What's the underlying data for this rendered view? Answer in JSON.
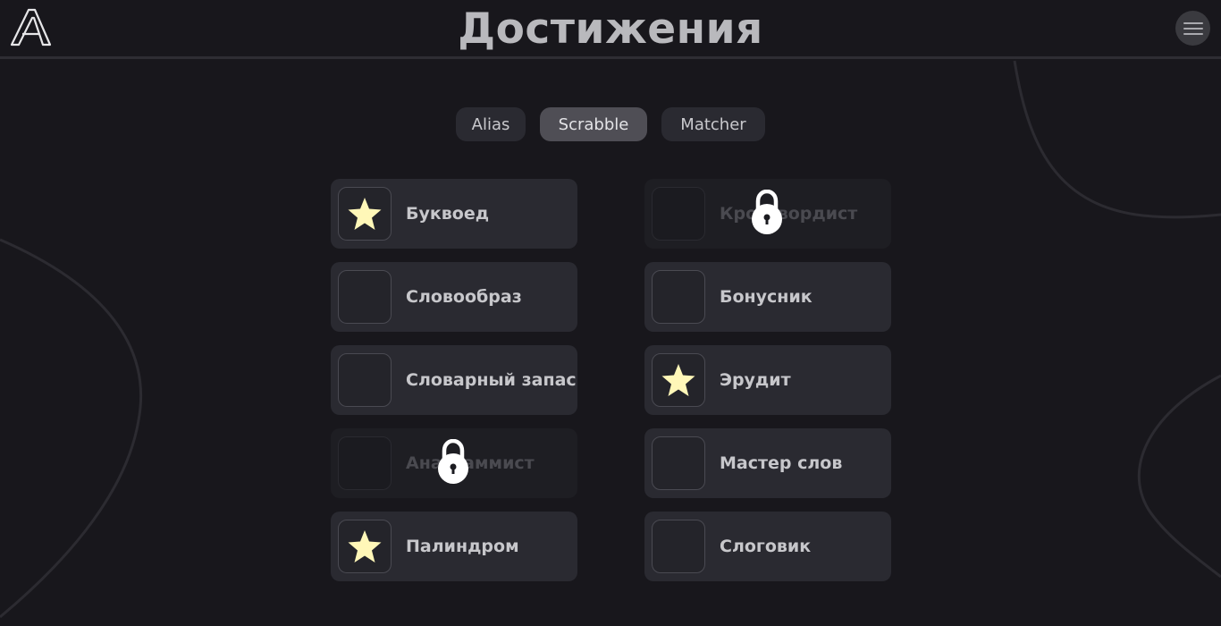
{
  "header": {
    "title": "Достижения",
    "logo_icon": "logo-a-icon",
    "menu_icon": "hamburger-menu-icon"
  },
  "tabs": [
    {
      "label": "Alias",
      "active": false
    },
    {
      "label": "Scrabble",
      "active": true
    },
    {
      "label": "Matcher",
      "active": false
    }
  ],
  "achievements": [
    {
      "label": "Буквоед",
      "unlocked": true,
      "locked": false,
      "icon": "star-icon"
    },
    {
      "label": "Кроссвордист",
      "unlocked": false,
      "locked": true,
      "icon": "lock-icon"
    },
    {
      "label": "Словообраз",
      "unlocked": false,
      "locked": false,
      "icon": ""
    },
    {
      "label": "Бонусник",
      "unlocked": false,
      "locked": false,
      "icon": ""
    },
    {
      "label": "Словарный запас",
      "unlocked": false,
      "locked": false,
      "icon": ""
    },
    {
      "label": "Эрудит",
      "unlocked": true,
      "locked": false,
      "icon": "star-icon"
    },
    {
      "label": "Анаграммист",
      "unlocked": false,
      "locked": true,
      "icon": "lock-icon"
    },
    {
      "label": "Мастер слов",
      "unlocked": false,
      "locked": false,
      "icon": ""
    },
    {
      "label": "Палиндром",
      "unlocked": true,
      "locked": false,
      "icon": "star-icon"
    },
    {
      "label": "Слоговик",
      "unlocked": false,
      "locked": false,
      "icon": ""
    }
  ],
  "colors": {
    "background": "#18171c",
    "card": "#2a2a31",
    "tab_active": "#4f4e55",
    "star": "#fff7b8",
    "text": "#c7c7cb"
  }
}
